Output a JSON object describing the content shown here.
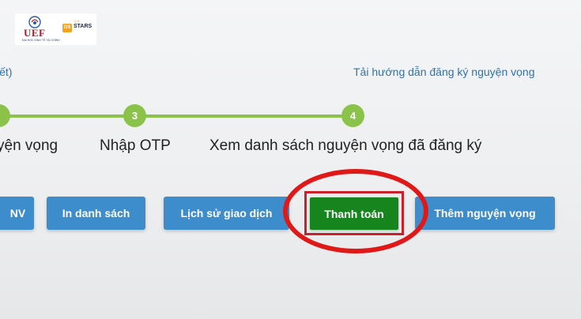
{
  "header": {
    "logo_uef_text": "UEF",
    "logo_uef_subtitle": "ĐẠI HỌC KINH TẾ TÀI CHÍNH",
    "logo_stars_badge": "GS",
    "logo_stars_text": "STARS",
    "logo_stars_top": "QS",
    "partial_text": "iết)",
    "guide_link": "Tải hướng dẫn đăng ký nguyện vọng"
  },
  "steps": [
    {
      "number": "",
      "label": "yện vọng"
    },
    {
      "number": "3",
      "label": "Nhập OTP"
    },
    {
      "number": "4",
      "label": "Xem danh sách nguyện vọng đã đăng ký"
    }
  ],
  "actions": {
    "nv": "NV",
    "print_list": "In danh sách",
    "history": "Lịch sử giao dịch",
    "pay": "Thanh toán",
    "add": "Thêm nguyện vọng"
  },
  "colors": {
    "accent_blue": "#3d8ccc",
    "link_blue": "#2f73a8",
    "step_green": "#8bc34a",
    "pay_green": "#17851e",
    "highlight_red": "#e01818"
  }
}
